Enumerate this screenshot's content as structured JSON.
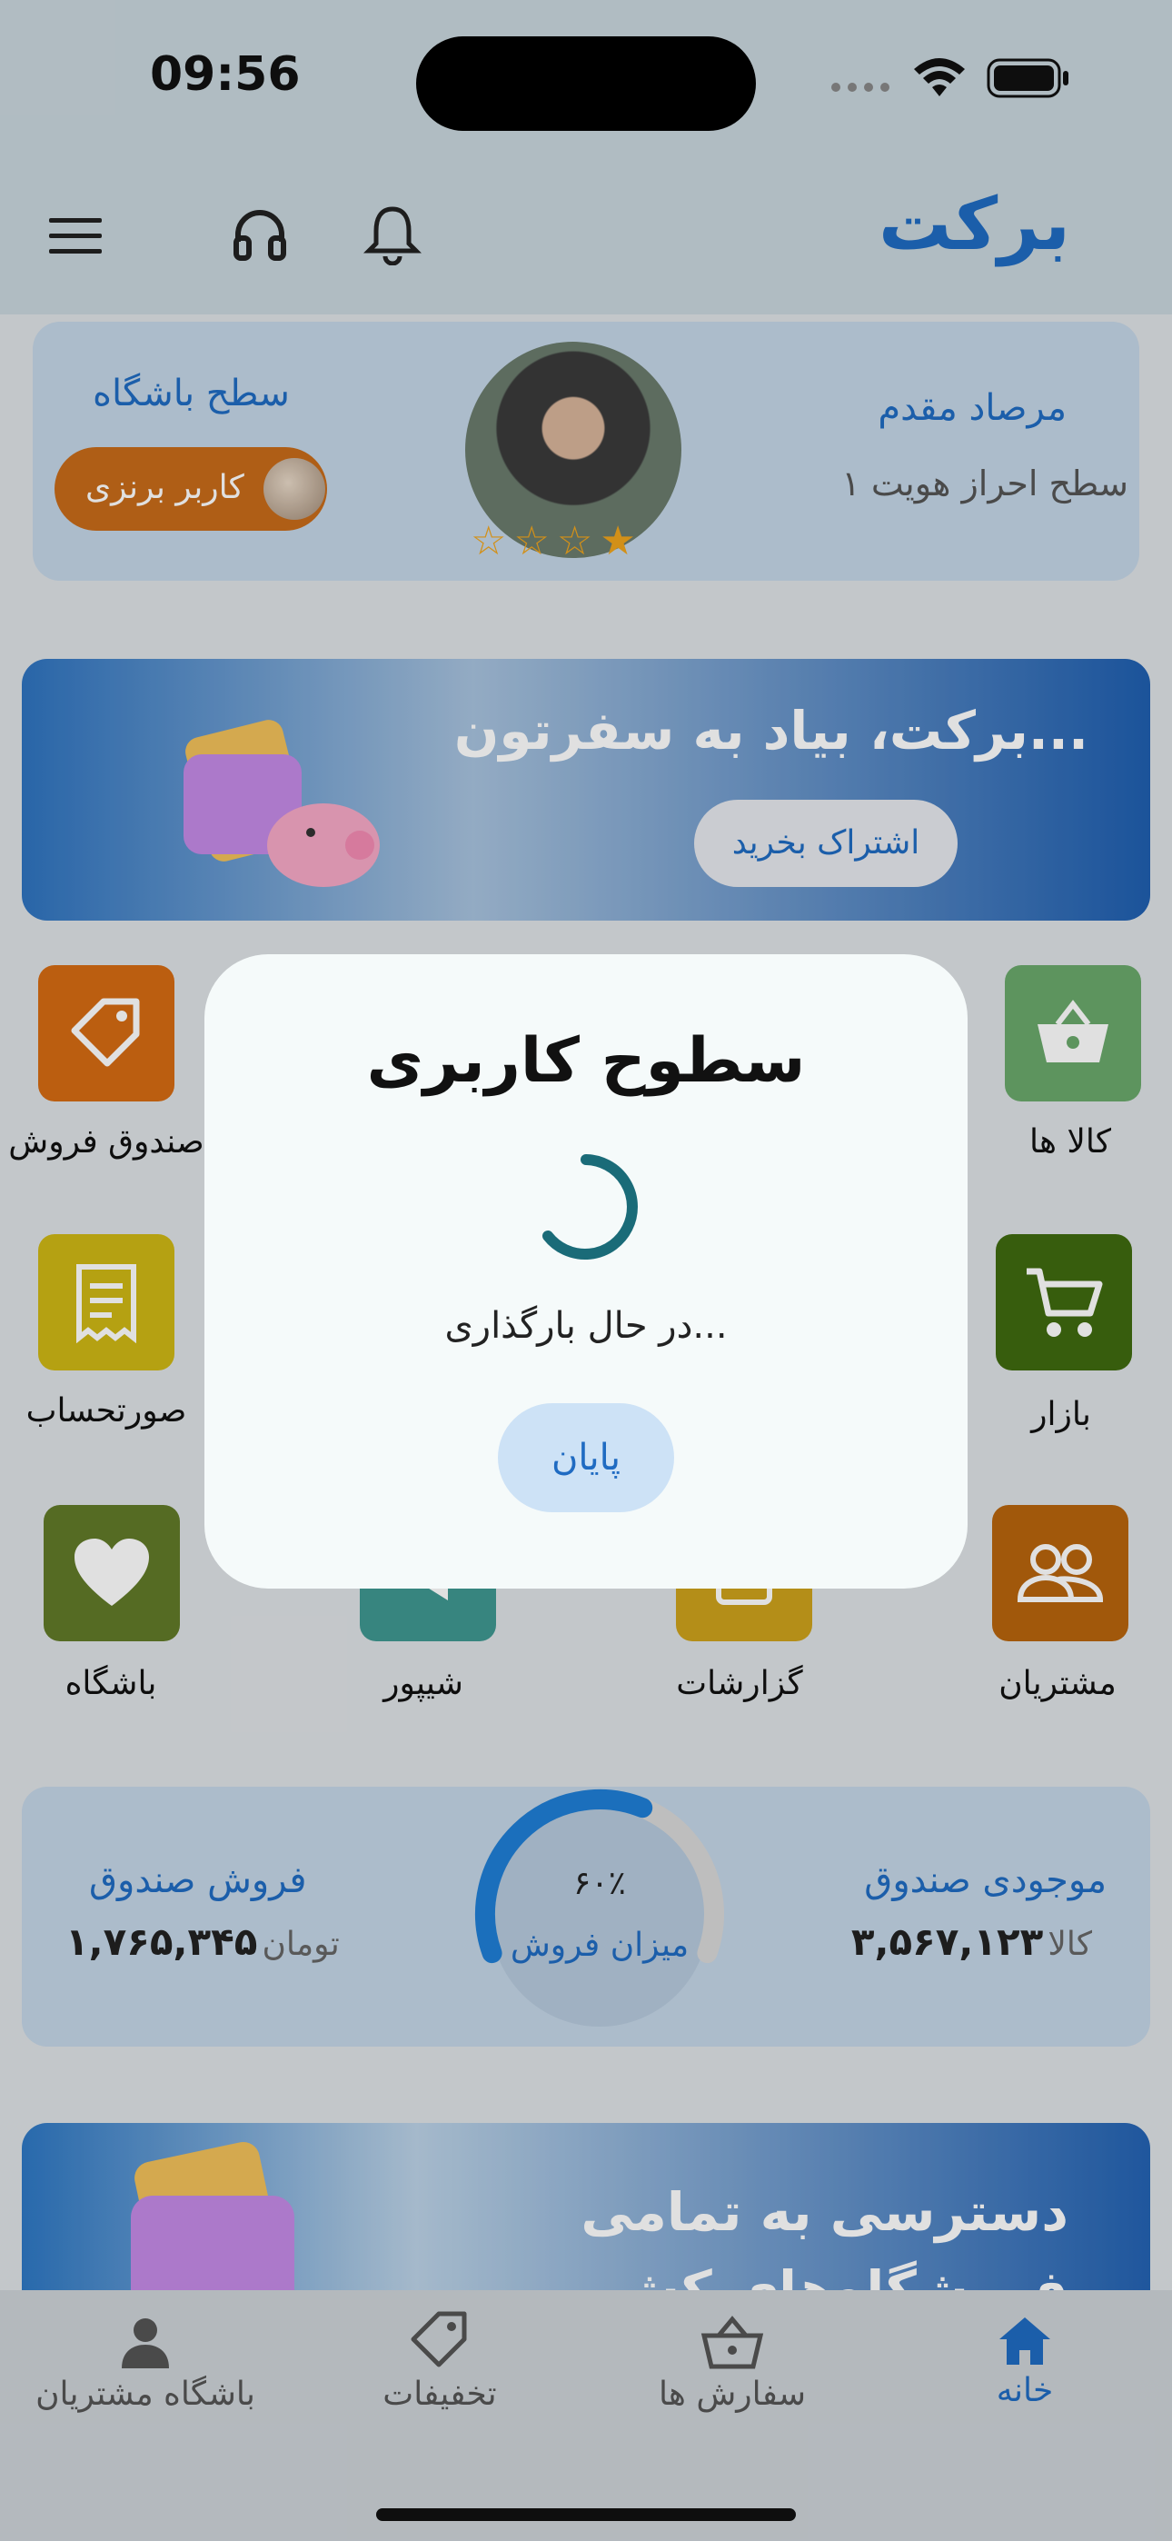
{
  "status_bar": {
    "time": "09:56"
  },
  "header": {
    "brand": "برکت"
  },
  "profile": {
    "name": "مرصاد مقدم",
    "verification_level": "سطح احراز هویت ۱",
    "club_level_title": "سطح باشگاه",
    "club_badge": "کاربر برنزی",
    "stars": "☆☆☆★"
  },
  "banner1": {
    "title": "برکت، بیاد به سفرتون...",
    "button": "اشتراک بخرید"
  },
  "tiles": [
    {
      "label": "صندوق فروش",
      "icon": "tag-icon",
      "color": "#d56b13"
    },
    {
      "label": "کالا ها",
      "icon": "basket-icon",
      "color": "#6aa96c"
    },
    {
      "label": "صورتحساب",
      "icon": "receipt-icon",
      "color": "#cfb815"
    },
    {
      "label": "بازار",
      "icon": "cart-icon",
      "color": "#3f6a0f"
    },
    {
      "label": "باشگاه",
      "icon": "heart-icon",
      "color": "#617a28"
    },
    {
      "label": "شیپور",
      "icon": "megaphone-icon",
      "color": "#3f9891"
    },
    {
      "label": "گزارشات",
      "icon": "report-icon",
      "color": "#cda21c"
    },
    {
      "label": "مشتریان",
      "icon": "users-icon",
      "color": "#b8650d"
    }
  ],
  "stats": {
    "inventory_title": "موجودی صندوق",
    "inventory_value": "۳,۵۶۷,۱۲۳",
    "inventory_unit": "کالا",
    "sales_title": "فروش صندوق",
    "sales_value": "۱,۷۶۵,۳۴۵",
    "sales_unit": "تومان",
    "gauge_percent": "۶۰٪",
    "gauge_fraction": 0.6,
    "gauge_label": "میزان فروش"
  },
  "banner2": {
    "title_line1": "دسترسی به تمامی",
    "title_line2": "فروشگاه‌های کش"
  },
  "tabbar": [
    {
      "label": "خانه",
      "icon": "home-icon",
      "active": true
    },
    {
      "label": "سفارش ها",
      "icon": "basket-icon",
      "active": false
    },
    {
      "label": "تخفیفات",
      "icon": "tag-icon",
      "active": false
    },
    {
      "label": "باشگاه مشتریان",
      "icon": "person-icon",
      "active": false
    }
  ],
  "dialog": {
    "title": "سطوح کاربری",
    "loading_text": "در حال بارگذاری...",
    "button": "پایان"
  },
  "colors": {
    "accent": "#1f6bc2",
    "spinner": "#1a6b78"
  }
}
